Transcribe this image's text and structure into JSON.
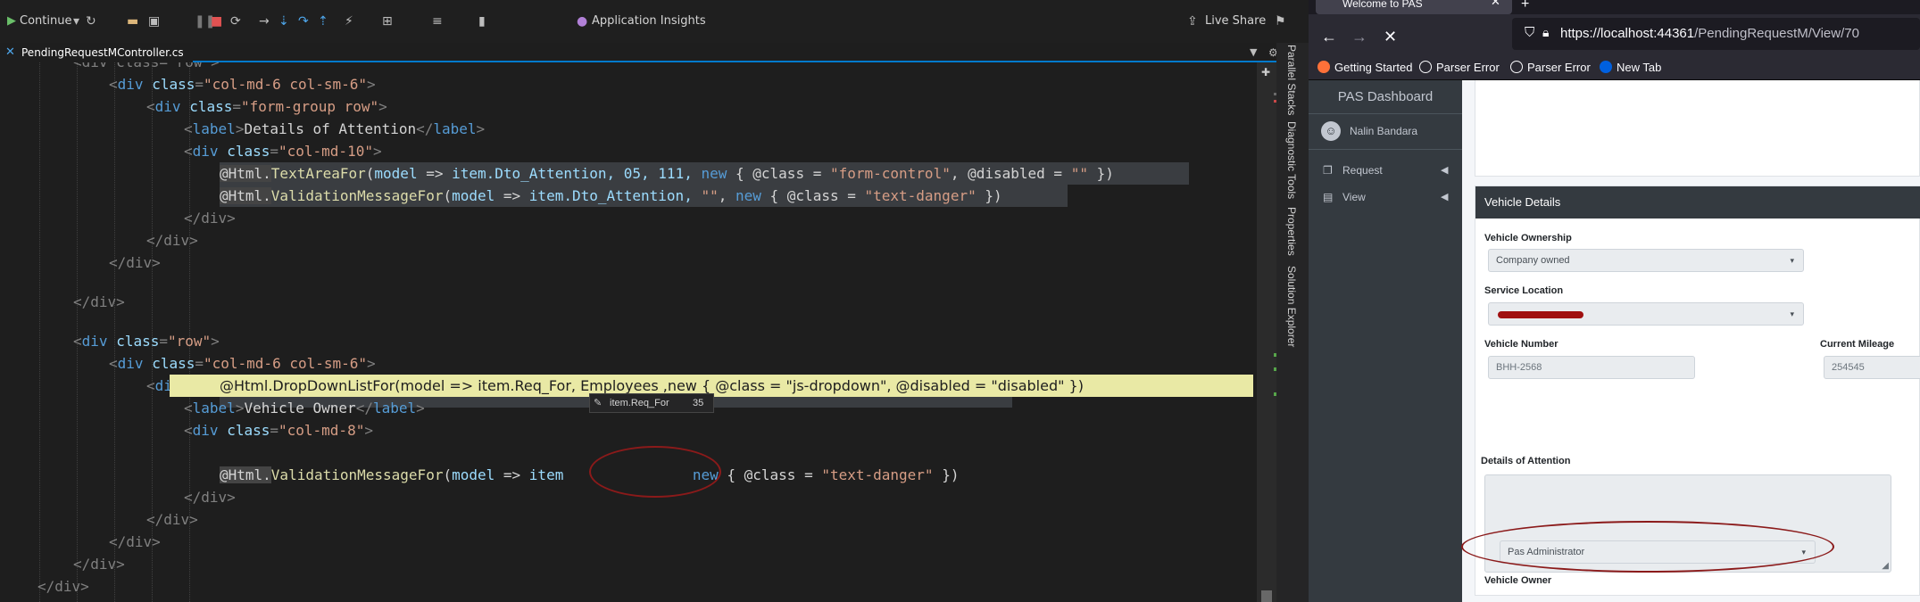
{
  "vs": {
    "toolbar": {
      "continue_label": "Continue",
      "app_insights_label": "Application Insights",
      "live_share_label": "Live Share"
    },
    "tab": {
      "filename": "PendingRequestMController.cs"
    },
    "side_tabs": [
      "Parallel Stacks",
      "Diagnostic Tools",
      "Properties",
      "Solution Explorer"
    ],
    "datatip": {
      "name": "item.Req_For",
      "value": "35"
    },
    "code": {
      "l0": "<div class=\"row\">",
      "l1_tag": "div",
      "l1_attr": "class",
      "l1_val": "\"col-md-6 col-sm-6\"",
      "l2_val": "\"form-group row\"",
      "l3_text": "Details of Attention",
      "l4_val": "\"col-md-10\"",
      "l5_method": "TextAreaFor",
      "l5_a": "model",
      "l5_b": "item.Dto_Attention, 05, 111, ",
      "l5_c": "new",
      "l5_d": " { @class = ",
      "l5_e": "\"form-control\"",
      "l5_f": ", @disabled = ",
      "l5_g": "\"\"",
      "l5_h": " })",
      "l6_method": "ValidationMessageFor",
      "l6_b": "item.Dto_Attention, ",
      "l6_e": "\"text-danger\"",
      "l6_empty": "\"\"",
      "l12_val": "\"row\"",
      "l15_text": "Vehicle Owner",
      "l16_val": "\"col-md-8\"",
      "l17_full": "@Html.DropDownListFor(model => item.Req_For, Employees ,new { @class = \"js-dropdown\", @disabled = \"disabled\" })",
      "l18_method": "ValidationMessageFor",
      "l18_b": "item",
      "l18_c": "new",
      "l18_d": " { @class = ",
      "l18_e": "\"text-danger\"",
      "l18_h": " })",
      "html_prefix": "@Html.",
      "arrow": " => ",
      "open": "(",
      "comma": ", ",
      "close_div": "</div>",
      "div": "div",
      "label": "label",
      "class_attr": "class"
    }
  },
  "browser": {
    "tab_title": "Welcome to PAS",
    "url_host": "https://localhost:44361",
    "url_path": "/PendingRequestM/View/70",
    "bookmarks": [
      "Getting Started",
      "Parser Error",
      "Parser Error",
      "New Tab"
    ],
    "app": {
      "brand": "PAS Dashboard",
      "user_name": "Nalin Bandara",
      "nav": [
        {
          "label": "Request"
        },
        {
          "label": "View"
        }
      ],
      "card_title": "Vehicle Details",
      "fields": {
        "ownership_label": "Vehicle Ownership",
        "ownership_value": "Company owned",
        "location_label": "Service Location",
        "vehicle_number_label": "Vehicle Number",
        "vehicle_number_value": "BHH-2568",
        "mileage_label": "Current Mileage",
        "mileage_value": "254545",
        "attention_label": "Details of Attention",
        "owner_label": "Vehicle Owner",
        "owner_value": "Pas Administrator"
      }
    }
  },
  "colors": {
    "vs_bg": "#1e1e1e",
    "vs_accent": "#007acc",
    "highlight_line": "#e9e9a5",
    "annotation_red": "#8b1a1a",
    "sidebar_dark": "#343a40"
  }
}
